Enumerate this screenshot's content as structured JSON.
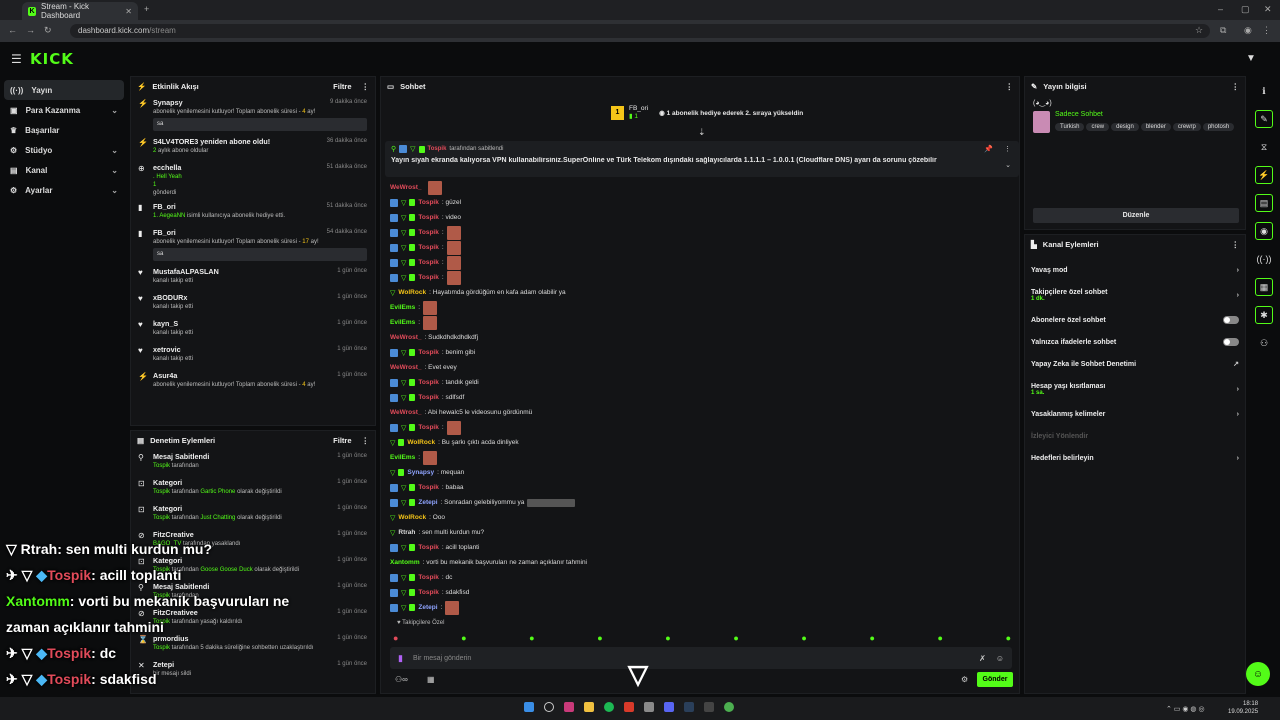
{
  "browser": {
    "tab_title": "Stream - Kick Dashboard",
    "url_domain": "dashboard.kick.com",
    "url_path": "/stream"
  },
  "app": {
    "logo": "KICK"
  },
  "nav": [
    {
      "label": "Yayın",
      "icon": "broadcast-icon",
      "active": true,
      "chevron": false
    },
    {
      "label": "Para Kazanma",
      "icon": "dollar-icon",
      "chevron": true
    },
    {
      "label": "Başarılar",
      "icon": "trophy-icon",
      "chevron": false
    },
    {
      "label": "Stüdyo",
      "icon": "gear-icon",
      "chevron": true
    },
    {
      "label": "Kanal",
      "icon": "channel-icon",
      "chevron": true
    },
    {
      "label": "Ayarlar",
      "icon": "settings-icon",
      "chevron": true
    }
  ],
  "activity": {
    "title": "Etkinlik Akışı",
    "filter": "Filtre",
    "items": [
      {
        "name": "Synapsy",
        "time": "9 dakika önce",
        "sub": "abonelik yenilemesini kutluyor! Toplam abonelik süresi - ",
        "hl": "4",
        "end": " ay!",
        "box": "sa"
      },
      {
        "name": "S4LV4TORE3 yeniden abone oldu!",
        "time": "36 dakika önce",
        "sub": " aylık abone oldular",
        "hl": "2",
        "end": ""
      },
      {
        "name": "ecchella",
        "time": "51 dakika önce",
        "sub": ". Hell Yeah",
        "hl": "",
        "end": "",
        "extra": "1",
        "extra2": "gönderdi"
      },
      {
        "name": "FB_ori",
        "time": "51 dakika önce",
        "sub": " isimli kullanıcıya abonelik hediye etti.",
        "hl": "1. AegeaNN",
        "end": ""
      },
      {
        "name": "FB_ori",
        "time": "54 dakika önce",
        "sub": "abonelik yenilemesini kutluyor! Toplam abonelik süresi - ",
        "hl": "17",
        "end": " ay!",
        "box": "sa"
      },
      {
        "name": "MustafaALPASLAN",
        "time": "1 gün önce",
        "sub": "kanalı takip etti"
      },
      {
        "name": "xBODURx",
        "time": "1 gün önce",
        "sub": "kanalı takip etti"
      },
      {
        "name": "kayn_S",
        "time": "1 gün önce",
        "sub": "kanalı takip etti"
      },
      {
        "name": "xetrovic",
        "time": "1 gün önce",
        "sub": "kanalı takip etti"
      },
      {
        "name": "Asur4a",
        "time": "1 gün önce",
        "sub": "abonelik yenilemesini kutluyor! Toplam abonelik süresi - ",
        "hl": "4",
        "end": " ay!"
      }
    ]
  },
  "moderation": {
    "title": "Denetim Eylemleri",
    "filter": "Filtre",
    "items": [
      {
        "name": "Mesaj Sabitlendi",
        "time": "1 gün önce",
        "by": "Tospik",
        "sub": " tarafından"
      },
      {
        "name": "Kategori",
        "time": "1 gün önce",
        "by": "Tospik",
        "sub": " tarafından ",
        "hl": "Gartic Phone",
        "end": " olarak değiştirildi"
      },
      {
        "name": "Kategori",
        "time": "1 gün önce",
        "by": "Tospik",
        "sub": " tarafından ",
        "hl": "Just Chatting",
        "end": " olarak değiştirildi"
      },
      {
        "name": "FitzCreative",
        "time": "1 gün önce",
        "by": "BAGO_TV",
        "sub": " tarafından yasaklandı"
      },
      {
        "name": "Kategori",
        "time": "1 gün önce",
        "by": "Tospik",
        "sub": " tarafından ",
        "hl": "Goose Goose Duck",
        "end": " olarak değiştirildi"
      },
      {
        "name": "Mesaj Sabitlendi",
        "time": "1 gün önce",
        "by": "Tospik",
        "sub": " tarafından"
      },
      {
        "name": "FitzCreativee",
        "time": "1 gün önce",
        "by": "Tospik",
        "sub": " tarafından yasağı kaldırıldı"
      },
      {
        "name": "prmordius",
        "time": "1 gün önce",
        "by": "Tospik",
        "sub": " tarafından 5 dakika süreliğine sohbetten uzaklaştırıldı"
      },
      {
        "name": "Zetepi",
        "time": "1 gün önce",
        "by": "",
        "sub": "bir mesajı sildi"
      }
    ]
  },
  "chat": {
    "title": "Sohbet",
    "gift_user": "FB_ori",
    "gift_count": "1",
    "gift_text": "1 abonelik hediye ederek 2. sıraya yükseldin",
    "pinned_by": "Tospik",
    "pinned_by_suffix": " tarafından sabitlendi",
    "pinned_text": "Yayın siyah ekranda kalıyorsa VPN kullanabilirsiniz.SuperOnline ve Türk Telekom dışındaki sağlayıcılarda 1.1.1.1 – 1.0.0.1 (Cloudflare DNS) ayarı da sorunu çözebilir",
    "messages": [
      {
        "u": "WeWrost_",
        "c": "#e14b5a",
        "m": "",
        "b": 0,
        "e": true
      },
      {
        "u": "Tospik",
        "c": "#e14b5a",
        "m": ": güzel",
        "b": 3
      },
      {
        "u": "Tospik",
        "c": "#e14b5a",
        "m": ": video",
        "b": 3
      },
      {
        "u": "Tospik",
        "c": "#e14b5a",
        "m": ":",
        "b": 3,
        "e": true
      },
      {
        "u": "Tospik",
        "c": "#e14b5a",
        "m": ":",
        "b": 3,
        "e": true
      },
      {
        "u": "Tospik",
        "c": "#e14b5a",
        "m": ":",
        "b": 3,
        "e": true
      },
      {
        "u": "Tospik",
        "c": "#e14b5a",
        "m": ":",
        "b": 3,
        "e": true
      },
      {
        "u": "WolRock",
        "c": "#f5c518",
        "m": ": Hayatımda gördüğüm en kafa adam olabilir ya",
        "b": 1
      },
      {
        "u": "EvilEms",
        "c": "#53fc18",
        "m": ":",
        "b": 0,
        "e": true
      },
      {
        "u": "EvilEms",
        "c": "#53fc18",
        "m": ":",
        "b": 0,
        "e": true
      },
      {
        "u": "WeWrost_",
        "c": "#e14b5a",
        "m": ": Sudkdhdkdhdkdfj",
        "b": 0
      },
      {
        "u": "Tospik",
        "c": "#e14b5a",
        "m": ": benim gibi",
        "b": 3
      },
      {
        "u": "WeWrost_",
        "c": "#e14b5a",
        "m": ": Evet evey",
        "b": 0
      },
      {
        "u": "Tospik",
        "c": "#e14b5a",
        "m": ": tandık geldi",
        "b": 3
      },
      {
        "u": "Tospik",
        "c": "#e14b5a",
        "m": ": sdlfsdf",
        "b": 3
      },
      {
        "u": "WeWrost_",
        "c": "#e14b5a",
        "m": ": Abi hewalc5 le videosunu gördünmü",
        "b": 0
      },
      {
        "u": "Tospik",
        "c": "#e14b5a",
        "m": ":",
        "b": 3,
        "e": true
      },
      {
        "u": "WolRock",
        "c": "#f5c518",
        "m": ": Bu şarkı çıktı acda dinliyek",
        "b": 2
      },
      {
        "u": "EvilEms",
        "c": "#53fc18",
        "m": ":",
        "b": 0,
        "e": true
      },
      {
        "u": "Synapsy",
        "c": "#8fa4ff",
        "m": ": mequan",
        "b": 2
      },
      {
        "u": "Tospik",
        "c": "#e14b5a",
        "m": ": babaa",
        "b": 3
      },
      {
        "u": "Zetepi",
        "c": "#8fa4ff",
        "m": ": Sonradan gelebiliyommu ya",
        "b": 3,
        "e": true
      },
      {
        "u": "WolRock",
        "c": "#f5c518",
        "m": ": Ooo",
        "b": 1
      },
      {
        "u": "Rtrah",
        "c": "#dddddd",
        "m": ": sen multi kurdun mu?",
        "b": 1
      },
      {
        "u": "Tospik",
        "c": "#e14b5a",
        "m": ": acill toplanti",
        "b": 3
      },
      {
        "u": "Xantomm",
        "c": "#53fc18",
        "m": ": vorti bu mekanik başvuruları ne zaman açıklanır tahmini",
        "b": 0
      },
      {
        "u": "Tospik",
        "c": "#e14b5a",
        "m": ": dc",
        "b": 3
      },
      {
        "u": "Tospik",
        "c": "#e14b5a",
        "m": ": sdakfisd",
        "b": 3
      },
      {
        "u": "Zetepi",
        "c": "#8fa4ff",
        "m": ":",
        "b": 3,
        "e": true
      }
    ],
    "followers_label": "Takipçilere Özel",
    "input_placeholder": "Bir mesaj gönderin",
    "send_label": "Gönder"
  },
  "stream_info": {
    "title": "Yayın bilgisi",
    "stream_title": "(◕‿◕)",
    "category": "Sadece Sohbet",
    "tags": [
      "Turkish",
      "crew",
      "design",
      "blender",
      "crewrp",
      "photosh"
    ],
    "edit_label": "Düzenle"
  },
  "channel_actions": {
    "title": "Kanal Eylemleri",
    "items": [
      {
        "label": "Yavaş mod",
        "type": "chev"
      },
      {
        "label": "Takipçilere özel sohbet",
        "sub": "1 dk.",
        "type": "chev"
      },
      {
        "label": "Abonelere özel sohbet",
        "type": "toggle"
      },
      {
        "label": "Yalnızca ifadelerle sohbet",
        "type": "toggle"
      },
      {
        "label": "Yapay Zeka ile Sohbet Denetimi",
        "type": "ext"
      },
      {
        "label": "Hesap yaşı kısıtlaması",
        "sub": "1 sa.",
        "type": "chev"
      },
      {
        "label": "Yasaklanmış kelimeler",
        "type": "chev"
      },
      {
        "label": "İzleyici Yönlendir",
        "type": "disabled"
      },
      {
        "label": "Hedefleri belirleyin",
        "type": "chev"
      }
    ]
  },
  "overlay": [
    {
      "u": "Rtrah",
      "c": "#ffffff",
      "m": ": sen multi kurdun mu?",
      "badges": 1
    },
    {
      "u": "Tospik",
      "c": "#e14b5a",
      "m": ": acill toplanti",
      "badges": 3
    },
    {
      "u": "Xantomm",
      "c": "#53fc18",
      "m": ": vorti bu mekanik başvuruları ne",
      "badges": 0
    },
    {
      "u": "",
      "c": "#ffffff",
      "m": "zaman açıklanır tahmini",
      "badges": 0
    },
    {
      "u": "Tospik",
      "c": "#e14b5a",
      "m": ": dc",
      "badges": 3
    },
    {
      "u": "Tospik",
      "c": "#e14b5a",
      "m": ": sdakfisd",
      "badges": 3
    },
    {
      "u": "Zetepi",
      "c": "#8fa4ff",
      "m": ":",
      "badges": 2
    }
  ],
  "taskbar": {
    "time": "18:18",
    "date": "19.09.2025"
  }
}
